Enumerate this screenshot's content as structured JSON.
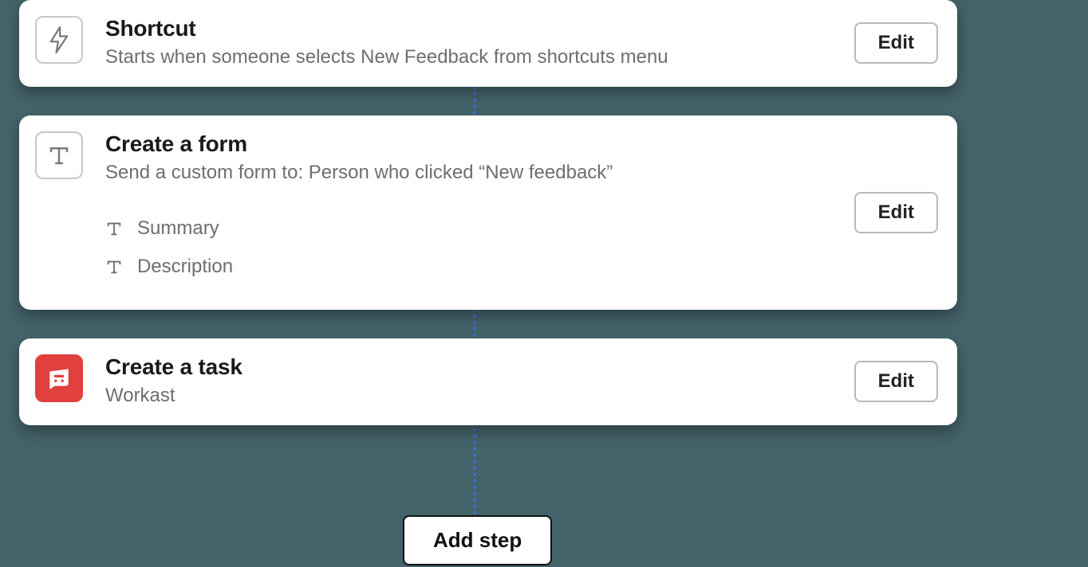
{
  "steps": [
    {
      "icon": "lightning-icon",
      "title": "Shortcut",
      "subtitle": "Starts when someone selects New Feedback from shortcuts menu",
      "edit_label": "Edit"
    },
    {
      "icon": "text-icon",
      "title": "Create a form",
      "subtitle": "Send a custom form to:  Person who clicked “New feedback”",
      "edit_label": "Edit",
      "fields": [
        {
          "icon": "text-icon",
          "label": "Summary"
        },
        {
          "icon": "text-icon",
          "label": "Description"
        }
      ]
    },
    {
      "icon": "workast-icon",
      "title": "Create a task",
      "subtitle": "Workast",
      "edit_label": "Edit"
    }
  ],
  "add_step_label": "Add step"
}
